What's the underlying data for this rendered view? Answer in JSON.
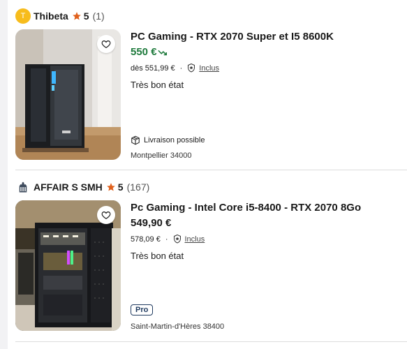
{
  "listings": [
    {
      "seller_initial": "T",
      "seller_name": "Thibeta",
      "rating": "5",
      "review_count": "(1)",
      "title": "PC Gaming - RTX 2070 Super et I5 8600K",
      "price": "550 €",
      "subprice": "dès 551,99 €",
      "protection_label": "Inclus",
      "condition": "Très bon état",
      "delivery": "Livraison possible",
      "location": "Montpellier 34000"
    },
    {
      "seller_name": "AFFAIR S SMH",
      "rating": "5",
      "review_count": "(167)",
      "title": "Pc Gaming - Intel Core i5-8400 - RTX 2070 8Go",
      "price": "549,90 €",
      "subprice": "578,09 €",
      "protection_label": "Inclus",
      "condition": "Très bon état",
      "pro_badge": "Pro",
      "location": "Saint-Martin-d'Hères 38400"
    }
  ],
  "colors": {
    "good_price": "#1e7a3c",
    "star": "#e0601c",
    "avatar": "#f7bc1c",
    "pro_badge": "#1f3a5f"
  },
  "icons": [
    "heart-icon",
    "star-icon",
    "shield-icon",
    "package-icon",
    "price-trend-down-icon",
    "shop-icon"
  ]
}
